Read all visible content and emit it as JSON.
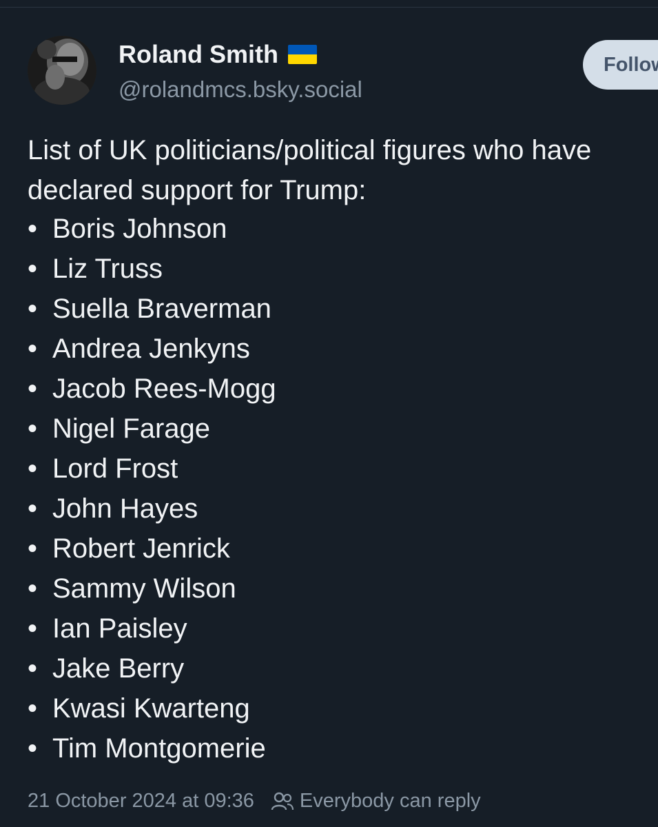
{
  "post": {
    "author": {
      "display_name": "Roland Smith",
      "flag_icon": "ukraine-flag",
      "handle": "@rolandmcs.bsky.social"
    },
    "follow_label": "Follow",
    "text_intro": "List of UK politicians/political figures who have declared support for Trump:",
    "bullet_char": "•",
    "items": [
      "Boris Johnson",
      "Liz Truss",
      "Suella Braverman",
      "Andrea Jenkyns",
      "Jacob Rees-Mogg",
      "Nigel Farage",
      "Lord Frost",
      "John Hayes",
      "Robert Jenrick",
      "Sammy Wilson",
      "Ian Paisley",
      "Jake Berry",
      "Kwasi Kwarteng",
      "Tim Montgomerie"
    ],
    "timestamp": "21 October 2024 at 09:36",
    "reply_setting": "Everybody can reply",
    "reply_icon": "people-icon"
  },
  "colors": {
    "background": "#161e27",
    "text": "#f1f3f5",
    "muted": "#8b98a5",
    "follow_bg": "#d4dee8",
    "flag_blue": "#0057b7",
    "flag_yellow": "#ffd700"
  }
}
